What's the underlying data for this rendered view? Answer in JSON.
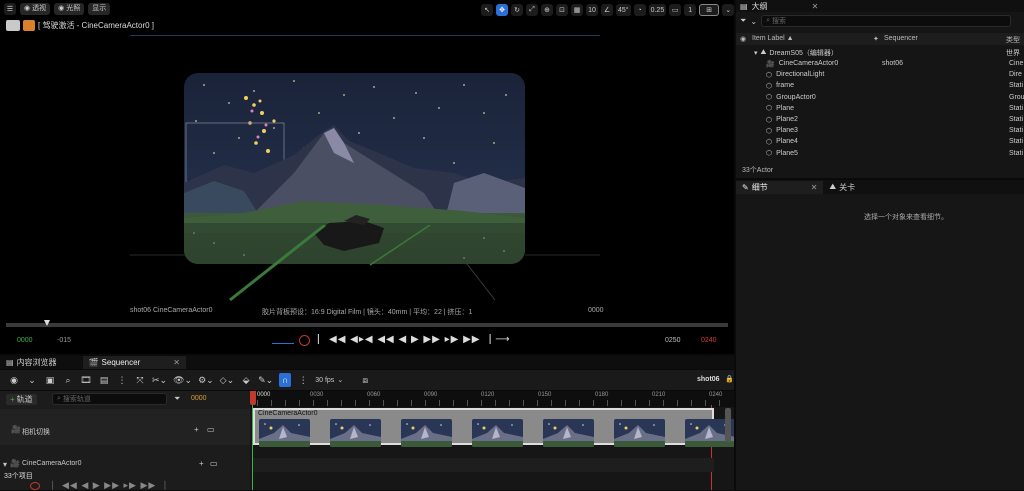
{
  "viewport": {
    "toolbar": {
      "menu_icon": "hamburger-icon",
      "perspective_label": "透视",
      "lit_label": "光照",
      "show_label": "显示",
      "grid_size": "10",
      "angle_snap": "45°",
      "scale_snap": "0.25",
      "camera_speed": "1"
    },
    "pilot_label": "[ 驾驶激活 - CineCameraActor0 ]",
    "overlay": {
      "shot_camera": "shot06 CineCameraActor0",
      "filmback": "胶片背板预设：16:9 Digital Film | 镜头：40mm | 平均：22 | 挤压：1",
      "frame": "0000"
    },
    "transport": {
      "start_frame": "0000",
      "neg_offset": "-015",
      "end_frame": "0250",
      "end_frame2": "0240"
    }
  },
  "outliner": {
    "title": "大纲",
    "search_placeholder": "搜索",
    "columns": {
      "item_label": "Item Label ▲",
      "sequencer": "Sequencer",
      "type": "类型"
    },
    "root": {
      "label": "DreamS05（编辑器）",
      "type": "世界"
    },
    "items": [
      {
        "label": "CineCameraActor0",
        "sequencer": "shot06",
        "type": "Cine"
      },
      {
        "label": "DirectionalLight",
        "sequencer": "",
        "type": "Dire"
      },
      {
        "label": "frame",
        "sequencer": "",
        "type": "Stati"
      },
      {
        "label": "GroupActor0",
        "sequencer": "",
        "type": "Grou"
      },
      {
        "label": "Plane",
        "sequencer": "",
        "type": "Stati"
      },
      {
        "label": "Plane2",
        "sequencer": "",
        "type": "Stati"
      },
      {
        "label": "Plane3",
        "sequencer": "",
        "type": "Stati"
      },
      {
        "label": "Plane4",
        "sequencer": "",
        "type": "Stati"
      },
      {
        "label": "Plane5",
        "sequencer": "",
        "type": "Stati"
      }
    ],
    "actor_count": "33个Actor"
  },
  "details": {
    "tab_details": "细节",
    "tab_level": "关卡",
    "empty_hint": "选择一个对象来查看细节。"
  },
  "bottom": {
    "tab_content_browser": "内容浏览器",
    "tab_sequencer": "Sequencer",
    "fps_label": "30 fps",
    "shot_name": "shot06",
    "add_track_label": "轨道",
    "track_search_placeholder": "搜索轨道",
    "current_frame": "0000",
    "tracks": {
      "camera_cut": "相机切换",
      "cine_camera": "CineCameraActor0"
    },
    "item_count": "33个项目",
    "ruler": {
      "start": "0000",
      "ticks": [
        "0030",
        "0060",
        "0090",
        "0120",
        "0150",
        "0180",
        "0210",
        "0240"
      ]
    },
    "shot_track_label": "CineCameraActor0"
  },
  "colors": {
    "accent_blue": "#2c6fd6",
    "playhead": "#c0392b",
    "end_red": "#e03b3b",
    "start_green": "#3bb34a"
  }
}
